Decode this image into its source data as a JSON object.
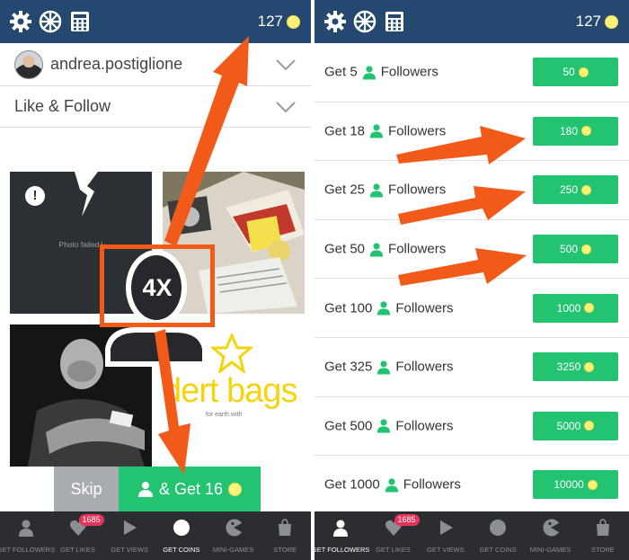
{
  "accent": "#22c472",
  "header_color": "#24486f",
  "arrow_color": "#f25a1a",
  "coin_color": "#fff27a",
  "left": {
    "topbar": {
      "icons": [
        "settings-gear-icon",
        "wheel-icon",
        "calculator-icon"
      ],
      "coins": "127"
    },
    "account": {
      "username": "andrea.postiglione"
    },
    "mode": {
      "label": "Like & Follow"
    },
    "tiles": {
      "failed_text": "Photo failed l",
      "logo_text": "dert bags",
      "logo_tagline": "for earth with"
    },
    "badge": "4X",
    "skip_label": "Skip",
    "get_label": "& Get 16"
  },
  "right": {
    "topbar": {
      "coins": "127"
    },
    "offers": [
      {
        "prefix": "Get 5",
        "suffix": "Followers",
        "price": "50"
      },
      {
        "prefix": "Get 18",
        "suffix": "Followers",
        "price": "180"
      },
      {
        "prefix": "Get 25",
        "suffix": "Followers",
        "price": "250"
      },
      {
        "prefix": "Get 50",
        "suffix": "Followers",
        "price": "500"
      },
      {
        "prefix": "Get 100",
        "suffix": "Followers",
        "price": "1000"
      },
      {
        "prefix": "Get 325",
        "suffix": "Followers",
        "price": "3250"
      },
      {
        "prefix": "Get 500",
        "suffix": "Followers",
        "price": "5000"
      },
      {
        "prefix": "Get 1000",
        "suffix": "Followers",
        "price": "10000"
      }
    ]
  },
  "nav": {
    "items": [
      {
        "label": "GET FOLLOWERS",
        "icon": "person-icon"
      },
      {
        "label": "GET LIKES",
        "icon": "heart-icon",
        "badge": "1685"
      },
      {
        "label": "GET VIEWS",
        "icon": "play-icon"
      },
      {
        "label": "GET COINS",
        "icon": "coin-icon"
      },
      {
        "label": "MINI-GAMES",
        "icon": "pacman-icon"
      },
      {
        "label": "STORE",
        "icon": "store-icon"
      }
    ],
    "left_active": "GET COINS",
    "right_active": "GET FOLLOWERS"
  }
}
